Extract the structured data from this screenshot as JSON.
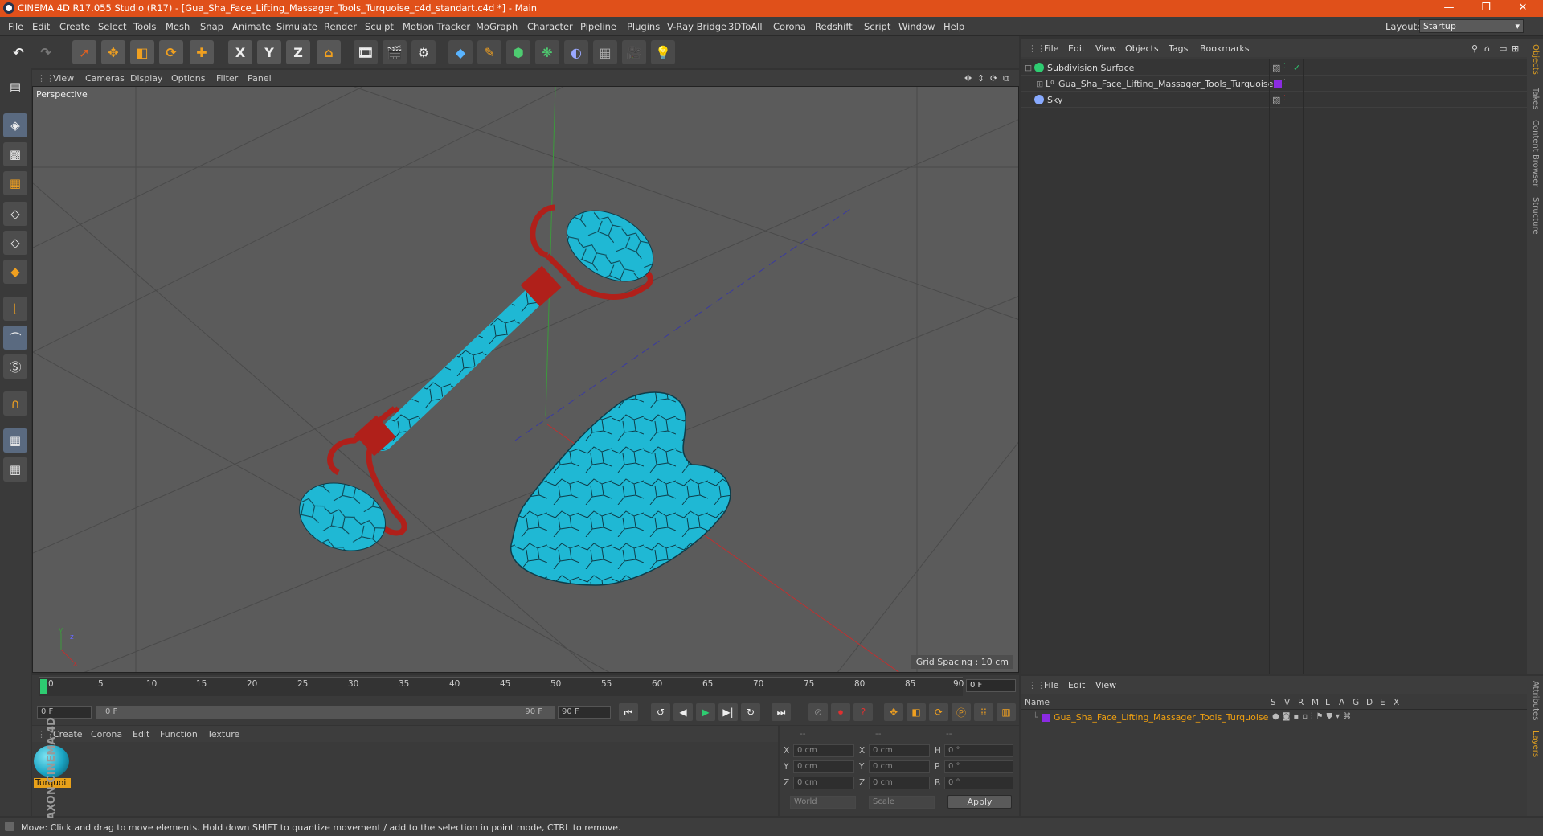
{
  "window": {
    "title": "CINEMA 4D R17.055 Studio (R17) - [Gua_Sha_Face_Lifting_Massager_Tools_Turquoise_c4d_standart.c4d *] - Main",
    "controls": [
      "—",
      "❐",
      "✕"
    ]
  },
  "menubar": {
    "items": [
      "File",
      "Edit",
      "Create",
      "Select",
      "Tools",
      "Mesh",
      "Snap",
      "Animate",
      "Simulate",
      "Render",
      "Sculpt",
      "Motion Tracker",
      "MoGraph",
      "Character",
      "Pipeline",
      "Plugins",
      "V-Ray Bridge",
      "3DToAll",
      "Corona",
      "Redshift",
      "Script",
      "Window",
      "Help"
    ],
    "layout_label": "Layout:",
    "layout_value": "Startup"
  },
  "toolbar": {
    "icons": [
      "undo-icon",
      "redo-icon",
      "select-icon",
      "move-icon",
      "scale-icon",
      "rotate-icon",
      "move-add-icon",
      "x-axis-icon",
      "y-axis-icon",
      "z-axis-icon",
      "coord-icon",
      "render-view-icon",
      "render-icon",
      "render-settings-icon",
      "cube-icon",
      "pen-icon",
      "subdivision-icon",
      "mograph-icon",
      "deformer-icon",
      "floor-icon",
      "camera-icon",
      "light-icon"
    ],
    "axis_labels": [
      "X",
      "Y",
      "Z"
    ]
  },
  "viewport": {
    "menu": [
      "View",
      "Cameras",
      "Display",
      "Options",
      "Filter",
      "Panel"
    ],
    "label": "Perspective",
    "grid_spacing": "Grid Spacing : 10 cm",
    "colors": {
      "model": "#1fb8d4",
      "frame": "#b0201a",
      "crack": "#0d3d4a",
      "bg": "#5b5b5b"
    }
  },
  "timeline": {
    "ticks": [
      "0",
      "5",
      "10",
      "15",
      "20",
      "25",
      "30",
      "35",
      "40",
      "45",
      "50",
      "55",
      "60",
      "65",
      "70",
      "75",
      "80",
      "85",
      "90"
    ],
    "current_frame": "0 F"
  },
  "transport": {
    "start_field": "0 F",
    "range_left": "0 F",
    "range_right": "90 F",
    "end_field": "90 F"
  },
  "material_manager": {
    "menu": [
      "Create",
      "Corona",
      "Edit",
      "Function",
      "Texture"
    ],
    "materials": [
      {
        "name": "Turquoi"
      }
    ]
  },
  "coordinates": {
    "header": [
      "--",
      "--",
      "--"
    ],
    "rows": [
      {
        "a": "X",
        "v1": "0 cm",
        "b": "X",
        "v2": "0 cm",
        "c": "H",
        "v3": "0 °"
      },
      {
        "a": "Y",
        "v1": "0 cm",
        "b": "Y",
        "v2": "0 cm",
        "c": "P",
        "v3": "0 °"
      },
      {
        "a": "Z",
        "v1": "0 cm",
        "b": "Z",
        "v2": "0 cm",
        "c": "B",
        "v3": "0 °"
      }
    ],
    "world": "World",
    "scale": "Scale",
    "apply": "Apply"
  },
  "object_manager": {
    "menu": [
      "File",
      "Edit",
      "View",
      "Objects",
      "Tags",
      "Bookmarks"
    ],
    "objects": [
      {
        "name": "Subdivision Surface",
        "icon_color": "#2ecc71"
      },
      {
        "name": "Gua_Sha_Face_Lifting_Massager_Tools_Turquoise",
        "icon_color": "#aaaaaa"
      },
      {
        "name": "Sky",
        "icon_color": "#88aaff"
      }
    ]
  },
  "right_tabs": [
    "Objects",
    "Takes",
    "Content Browser",
    "Structure"
  ],
  "right_tabs_bottom": [
    "Attributes",
    "Layers"
  ],
  "layer_manager": {
    "menu": [
      "File",
      "Edit",
      "View"
    ],
    "columns": [
      "Name",
      "S",
      "V",
      "R",
      "M",
      "L",
      "A",
      "G",
      "D",
      "E",
      "X"
    ],
    "layers": [
      {
        "name": "Gua_Sha_Face_Lifting_Massager_Tools_Turquoise",
        "color": "#8b2be2"
      }
    ]
  },
  "status": {
    "text": "Move: Click and drag to move elements. Hold down SHIFT to quantize movement / add to the selection in point mode, CTRL to remove."
  },
  "branding": {
    "vertical": "MAXON CINEMA 4D"
  }
}
